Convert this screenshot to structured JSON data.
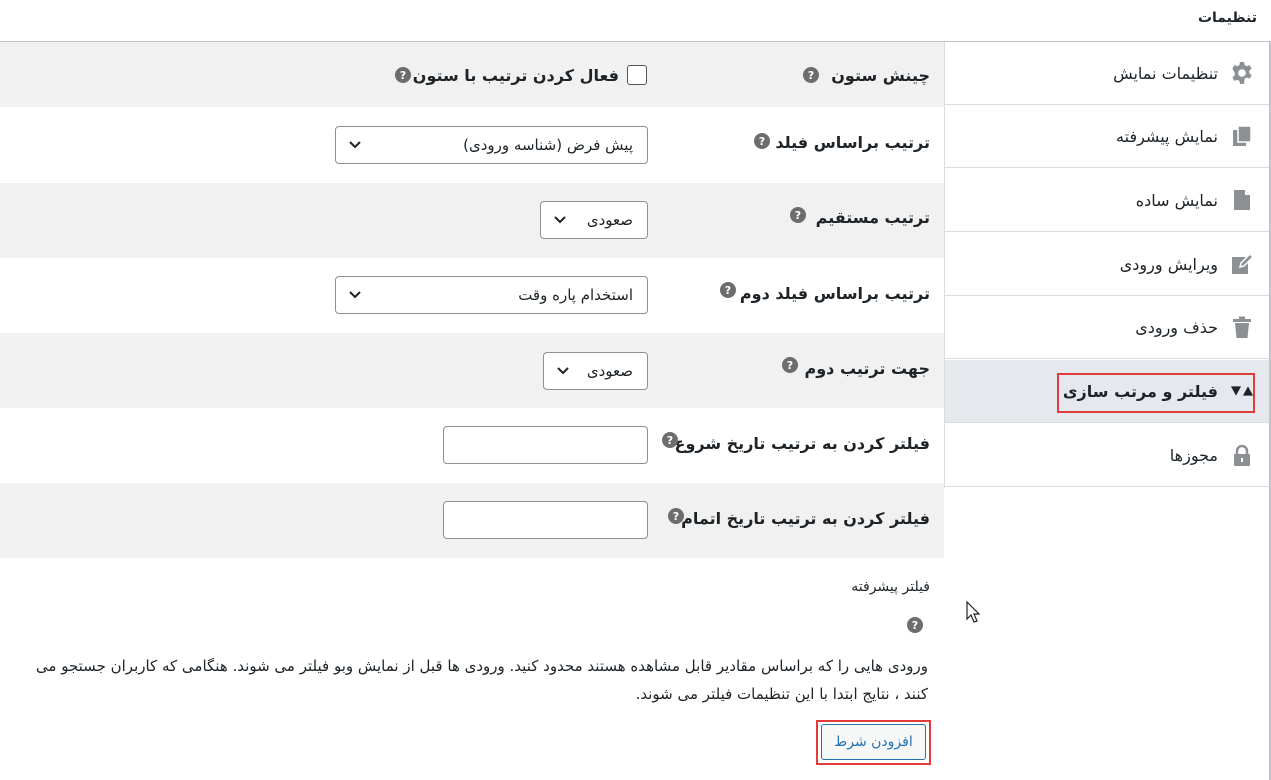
{
  "window": {
    "title": "تنظیمات"
  },
  "sidebar": {
    "items": [
      {
        "label": "تنظیمات نمایش",
        "icon": "gear-icon"
      },
      {
        "label": "نمایش پیشرفته",
        "icon": "copy-pages-icon"
      },
      {
        "label": "نمایش ساده",
        "icon": "page-icon"
      },
      {
        "label": "ویرایش ورودی",
        "icon": "edit-icon"
      },
      {
        "label": "حذف ورودی",
        "icon": "trash-icon"
      },
      {
        "label": "فیلتر و مرتب سازی",
        "icon": "sort-triangles-icon",
        "active": true
      },
      {
        "label": "مجوزها",
        "icon": "lock-icon"
      }
    ]
  },
  "settings": {
    "column_sort": {
      "label": "چینش ستون",
      "checkbox_label": "فعال کردن ترتیب با ستون",
      "checked": false
    },
    "sort_field": {
      "label": "ترتیب براساس فیلد",
      "value": "پیش فرض (شناسه ورودی)"
    },
    "sort_direction": {
      "label": "ترتیب مستقیم",
      "value": "صعودی"
    },
    "second_sort_field": {
      "label": "ترتیب براساس فیلد دوم",
      "value": "استخدام پاره وقت"
    },
    "second_sort_direction": {
      "label": "جهت ترتیب دوم",
      "value": "صعودی"
    },
    "filter_start_date": {
      "label": "فیلتر کردن به ترتیب تاریخ شروع",
      "value": ""
    },
    "filter_end_date": {
      "label": "فیلتر کردن به ترتیب تاریخ اتمام",
      "value": ""
    },
    "help_glyph": "?"
  },
  "advanced_filter": {
    "title": "فیلتر پیشرفته",
    "description": "ورودی هایی را که براساس مقادیر قابل مشاهده هستند محدود کنید. ورودی ها قبل از نمایش وبو فیلتر می شوند. هنگامی که کاربران جستجو می کنند ، نتایج ابتدا با این تنظیمات فیلتر می شوند.",
    "add_condition_label": "افزودن شرط"
  },
  "colors": {
    "accent": "#2271b1",
    "highlight": "#e23b3b",
    "active_bg": "#e5e9ee",
    "row_shade": "#f1f1f1"
  }
}
